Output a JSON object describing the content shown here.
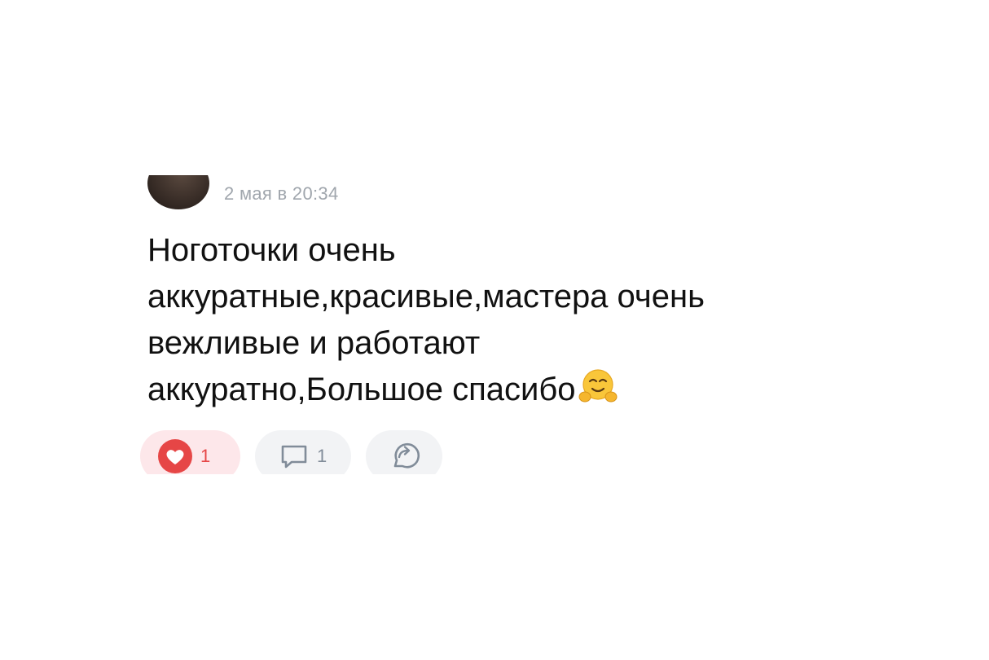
{
  "post": {
    "timestamp": "2 мая в 20:34",
    "text_lines": [
      "Ноготочки очень",
      "аккуратные,красивые,мастера очень",
      "вежливые и работают",
      "аккуратно,Большое спасибо"
    ]
  },
  "actions": {
    "like": {
      "count": "1",
      "icon": "heart-icon",
      "liked": true
    },
    "comment": {
      "count": "1",
      "icon": "comment-icon"
    },
    "share": {
      "icon": "share-icon"
    }
  },
  "colors": {
    "like_accent": "#e64646",
    "like_bg": "#fde7ea",
    "neutral_bg": "#f2f3f5",
    "muted_icon": "#818c99",
    "timestamp": "#a0a6ad",
    "text": "#111111"
  }
}
